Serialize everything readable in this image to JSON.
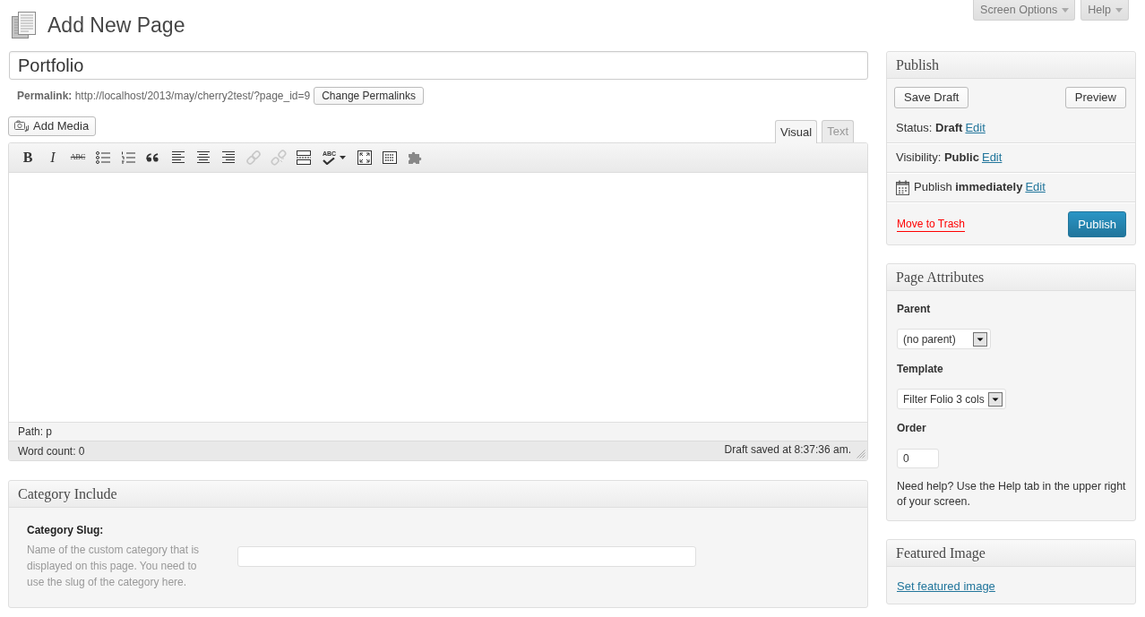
{
  "header": {
    "title": "Add New Page",
    "screen_options": "Screen Options",
    "help": "Help"
  },
  "title_field": {
    "value": "Portfolio"
  },
  "permalink": {
    "text": "**Permalink:** http://localhost/2013/may/cherry2test/?page_id=9",
    "button": "Change Permalinks"
  },
  "editor": {
    "add_media": "Add Media",
    "tabs": [
      {
        "label": "Visual",
        "selected": true
      },
      {
        "label": "Text",
        "selected": false
      }
    ],
    "toolbar": [
      {
        "kind": "bold",
        "label": "B",
        "disabled": false
      },
      {
        "kind": "italic",
        "label": "I",
        "disabled": false
      },
      {
        "kind": "strikethrough",
        "label": "ABC",
        "disabled": false
      },
      {
        "kind": "bullet-list",
        "disabled": false
      },
      {
        "kind": "numbered-list",
        "disabled": false
      },
      {
        "kind": "blockquote",
        "disabled": false
      },
      {
        "kind": "align-left",
        "disabled": false
      },
      {
        "kind": "align-center",
        "disabled": false
      },
      {
        "kind": "align-right",
        "disabled": false
      },
      {
        "kind": "link",
        "disabled": true
      },
      {
        "kind": "unlink",
        "disabled": true
      },
      {
        "kind": "more",
        "disabled": false
      },
      {
        "kind": "spellcheck",
        "label": "ABC",
        "disabled": false
      },
      {
        "kind": "fullscreen",
        "disabled": false
      },
      {
        "kind": "kitchen-sink",
        "disabled": false
      },
      {
        "kind": "plugin",
        "disabled": false
      }
    ],
    "path": "Path: p",
    "word_count": "Word count: 0",
    "autosave": "Draft saved at 8:37:36 am."
  },
  "category_include": {
    "title": "Category Include",
    "label": "Category Slug:",
    "description": "Name of the custom category that is displayed on this page. You need to use the slug of the category here."
  },
  "publish": {
    "title": "Publish",
    "save_draft": "Save Draft",
    "preview": "Preview",
    "rows": [
      {
        "kind": "status",
        "text": "Status: **Draft**",
        "link": "Edit"
      },
      {
        "kind": "visibility",
        "text": "Visibility: **Public**",
        "link": "Edit"
      },
      {
        "kind": "schedule",
        "text": "Publish **immediately**",
        "link": "Edit"
      }
    ],
    "trash": "Move to Trash",
    "publish_button": "Publish"
  },
  "page_attributes": {
    "title": "Page Attributes",
    "parent": {
      "label": "Parent",
      "value": "(no parent)"
    },
    "template": {
      "label": "Template",
      "value": "Filter Folio 3 cols"
    },
    "order": {
      "label": "Order",
      "value": "0"
    },
    "help": "Need help? Use the Help tab in the upper right of your screen."
  },
  "featured_image": {
    "title": "Featured Image",
    "link": "Set featured image"
  }
}
